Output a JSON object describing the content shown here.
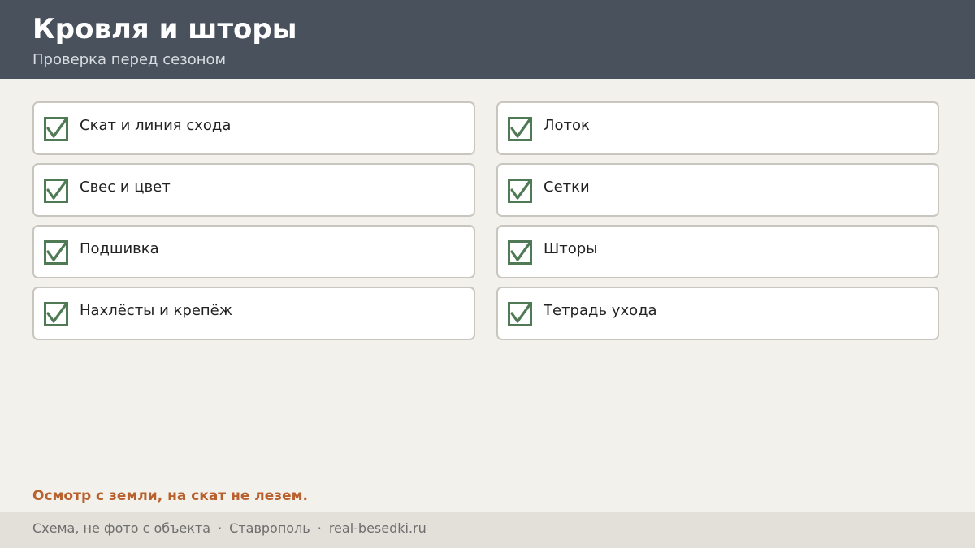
{
  "header": {
    "title": "Кровля и шторы",
    "subtitle": "Проверка перед сезоном"
  },
  "checklist": {
    "items": [
      {
        "label": "Скат и линия схода",
        "checked": true
      },
      {
        "label": "Лоток",
        "checked": true
      },
      {
        "label": "Свес и цвет",
        "checked": true
      },
      {
        "label": "Сетки",
        "checked": true
      },
      {
        "label": "Подшивка",
        "checked": true
      },
      {
        "label": "Шторы",
        "checked": true
      },
      {
        "label": "Нахлёсты и крепёж",
        "checked": true
      },
      {
        "label": "Тетрадь ухода",
        "checked": true
      }
    ]
  },
  "warning": "Осмотр с земли, на скат не лезем.",
  "footer": {
    "note": "Схема, не фото с объекта",
    "city": "Ставрополь",
    "site": "real-besedki.ru",
    "separator": "·"
  },
  "colors": {
    "header_bg": "#48515c",
    "page_bg": "#f3f1ec",
    "check_green": "#4f7a55",
    "warning_orange": "#b8612e",
    "footer_bg": "#e3e0d9"
  },
  "icons": {
    "checkbox": "checked-checkbox-icon"
  }
}
